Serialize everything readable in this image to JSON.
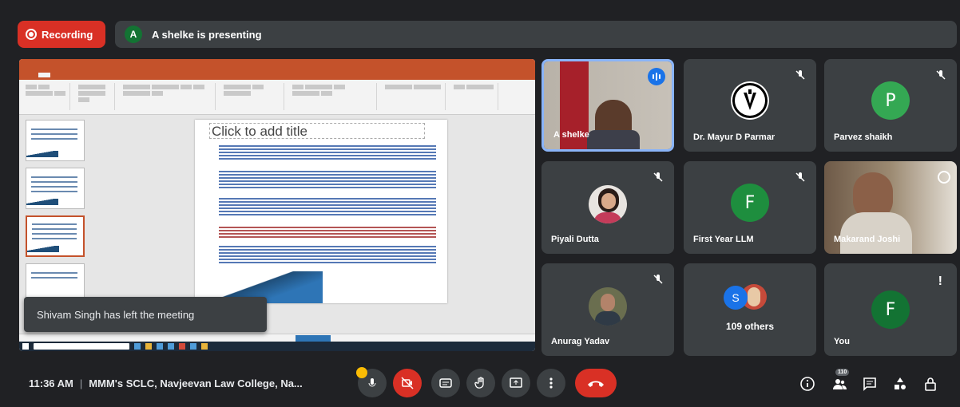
{
  "top": {
    "recording_label": "Recording",
    "presenter_initial": "A",
    "presenting_text": "A shelke is presenting"
  },
  "shared_screen": {
    "slide_title_placeholder": "Click to add title"
  },
  "toast": {
    "message": "Shivam Singh has left the meeting"
  },
  "participants": [
    {
      "name": "A shelke",
      "type": "video",
      "speaking": true
    },
    {
      "name": "Dr. Mayur D Parmar",
      "type": "logo",
      "muted": true
    },
    {
      "name": "Parvez shaikh",
      "type": "initial",
      "initial": "P",
      "color": "#34a853",
      "muted": true
    },
    {
      "name": "Piyali Dutta",
      "type": "photo",
      "muted": true
    },
    {
      "name": "First Year LLM",
      "type": "initial",
      "initial": "F",
      "color": "#1e8e3e",
      "muted": true
    },
    {
      "name": "Makarand Joshi",
      "type": "video"
    },
    {
      "name": "Anurag Yadav",
      "type": "photo",
      "muted": true
    },
    {
      "name": "109 others",
      "type": "group",
      "group_initial": "S"
    },
    {
      "name": "You",
      "type": "initial",
      "initial": "F",
      "color": "#137333"
    }
  ],
  "bottom": {
    "time": "11:36 AM",
    "meeting_name": "MMM's SCLC, Navjeevan Law College, Na...",
    "participant_count": "110"
  },
  "colors": {
    "background": "#202124",
    "tile": "#3c4043",
    "red": "#d93025",
    "blue": "#1a73e8"
  }
}
